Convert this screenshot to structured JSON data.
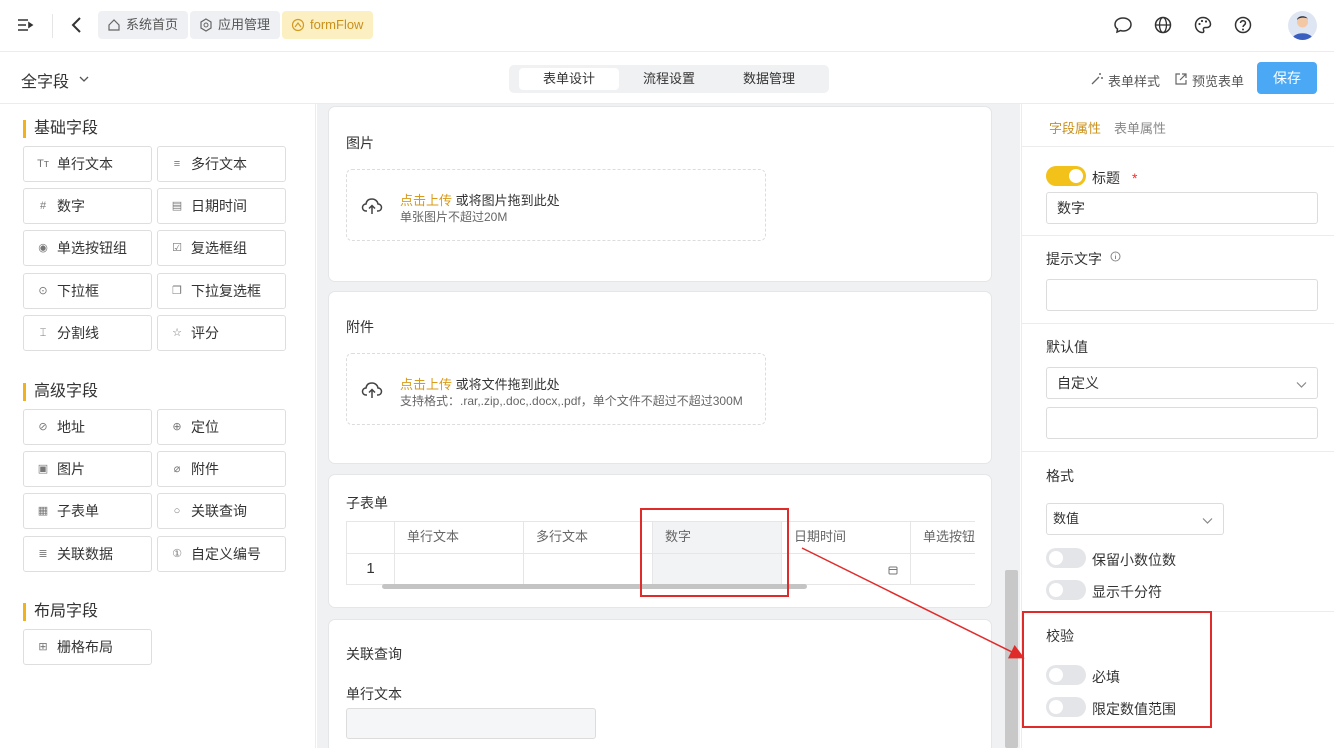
{
  "topbar": {
    "breadcrumbs": [
      {
        "label": "系统首页",
        "icon": "home-icon"
      },
      {
        "label": "应用管理",
        "icon": "apps-icon"
      },
      {
        "label": "formFlow",
        "icon": "flow-icon",
        "active": true
      }
    ],
    "icons": [
      "chat-icon",
      "globe-icon",
      "palette-icon",
      "help-icon"
    ]
  },
  "subbar": {
    "field_filter": "全字段",
    "tabs": [
      "表单设计",
      "流程设置",
      "数据管理"
    ],
    "active_tab": "表单设计",
    "form_style": "表单样式",
    "preview": "预览表单",
    "save": "保存"
  },
  "left": {
    "groups": [
      {
        "title": "基础字段",
        "items": [
          {
            "label": "单行文本",
            "icon": "text-icon"
          },
          {
            "label": "多行文本",
            "icon": "multiline-icon"
          },
          {
            "label": "数字",
            "icon": "hash-icon"
          },
          {
            "label": "日期时间",
            "icon": "calendar-icon"
          },
          {
            "label": "单选按钮组",
            "icon": "radio-icon"
          },
          {
            "label": "复选框组",
            "icon": "checkbox-icon"
          },
          {
            "label": "下拉框",
            "icon": "select-icon"
          },
          {
            "label": "下拉复选框",
            "icon": "multi-select-icon"
          },
          {
            "label": "分割线",
            "icon": "divider-icon"
          },
          {
            "label": "评分",
            "icon": "star-icon"
          }
        ]
      },
      {
        "title": "高级字段",
        "items": [
          {
            "label": "地址",
            "icon": "address-icon"
          },
          {
            "label": "定位",
            "icon": "locate-icon"
          },
          {
            "label": "图片",
            "icon": "image-icon"
          },
          {
            "label": "附件",
            "icon": "attachment-icon"
          },
          {
            "label": "子表单",
            "icon": "table-icon"
          },
          {
            "label": "关联查询",
            "icon": "search-icon"
          },
          {
            "label": "关联数据",
            "icon": "database-icon"
          },
          {
            "label": "自定义编号",
            "icon": "number-icon"
          }
        ]
      },
      {
        "title": "布局字段",
        "items": [
          {
            "label": "栅格布局",
            "icon": "grid-icon"
          }
        ]
      }
    ]
  },
  "canvas": {
    "image_card": {
      "title": "图片",
      "link": "点击上传",
      "hint": "或将图片拖到此处",
      "limit": "单张图片不超过20M"
    },
    "file_card": {
      "title": "附件",
      "link": "点击上传",
      "hint": "或将文件拖到此处",
      "limit": "支持格式：.rar,.zip,.doc,.docx,.pdf，单个文件不超过不超过300M"
    },
    "subform_card": {
      "title": "子表单",
      "columns": [
        "单行文本",
        "多行文本",
        "数字",
        "日期时间",
        "单选按钮组"
      ],
      "row_index": "1"
    },
    "lookup_card": {
      "title": "关联查询",
      "field_label": "单行文本"
    }
  },
  "right": {
    "tabs": [
      "字段属性",
      "表单属性"
    ],
    "active_tab": "字段属性",
    "title_toggle_label": "标题",
    "required_mark": "*",
    "title_value": "数字",
    "hint_label": "提示文字",
    "default_label": "默认值",
    "default_select": "自定义",
    "format_label": "格式",
    "format_select": "数值",
    "keep_decimals": "保留小数位数",
    "show_thousands": "显示千分符",
    "validate_label": "校验",
    "required": "必填",
    "limit_range": "限定数值范围"
  }
}
